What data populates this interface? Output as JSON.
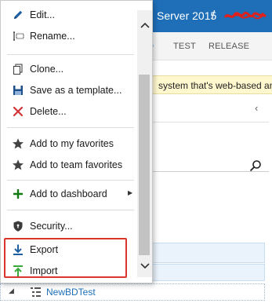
{
  "header": {
    "product": "Server 2015",
    "separator": "/"
  },
  "hubs": {
    "partial": "D",
    "test": "TEST",
    "release": "RELEASE"
  },
  "banner": {
    "text": "system that's web-based and"
  },
  "pane": {
    "collapse_glyph": "‹"
  },
  "tree": {
    "caret": "◢",
    "query_label": "NewBDTest"
  },
  "menu": {
    "items": [
      {
        "icon": "pencil-icon",
        "label": "Edit..."
      },
      {
        "icon": "rename-icon",
        "label": "Rename..."
      },
      {
        "icon": "clone-icon",
        "label": "Clone..."
      },
      {
        "icon": "save-icon",
        "label": "Save as a template..."
      },
      {
        "icon": "delete-x-icon",
        "label": "Delete..."
      },
      {
        "icon": "star-icon",
        "label": "Add to my favorites"
      },
      {
        "icon": "star-icon",
        "label": "Add to team favorites"
      },
      {
        "icon": "plus-icon",
        "label": "Add to dashboard",
        "submenu_glyph": "▶"
      },
      {
        "icon": "shield-icon",
        "label": "Security..."
      },
      {
        "icon": "export-arrow-icon",
        "label": "Export"
      },
      {
        "icon": "import-arrow-icon",
        "label": "Import"
      }
    ]
  },
  "colors": {
    "accent_blue": "#1e6fb8",
    "delete_red": "#d13438",
    "add_green": "#107c10",
    "import_green": "#3aa83a",
    "highlight_red": "#d9352d",
    "banner_yellow": "#fff8cf"
  }
}
